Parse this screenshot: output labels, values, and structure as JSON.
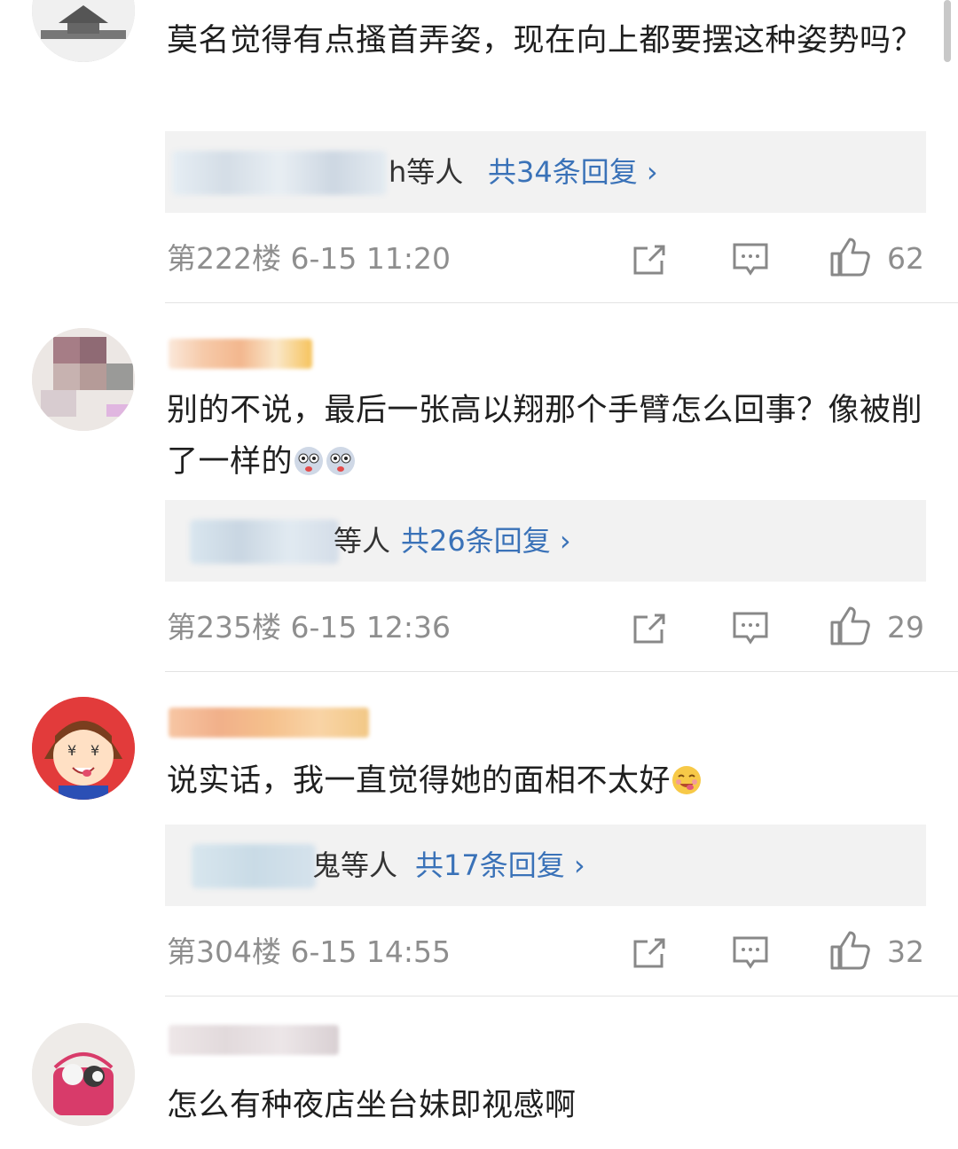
{
  "scrollbar": {
    "color": "#c8c8c8"
  },
  "comments": [
    {
      "text": "莫名觉得有点搔首弄姿，现在向上都要摆这种姿势吗？",
      "reply_users_visible": "h等人",
      "reply_link": "共34条回复 ›",
      "floor_time": "第222楼  6-15 11:20",
      "likes": "62"
    },
    {
      "text": "别的不说，最后一张高以翔那个手臂怎么回事？像被削了一样的",
      "emojis": [
        "dog-emoji",
        "dog-emoji"
      ],
      "reply_users_visible": "等人",
      "reply_link": "共26条回复 ›",
      "floor_time": "第235楼  6-15 12:36",
      "likes": "29"
    },
    {
      "text": "说实话，我一直觉得她的面相不太好",
      "emojis": [
        "yummy-face-emoji"
      ],
      "reply_users_visible": "鬼等人",
      "reply_link": "共17条回复 ›",
      "floor_time": "第304楼  6-15 14:55",
      "likes": "32"
    },
    {
      "text": "怎么有种夜店坐台妹即视感啊"
    }
  ],
  "colors": {
    "link": "#3a72b8",
    "meta": "#8e8e8e",
    "replybox_bg": "#f2f2f2"
  }
}
